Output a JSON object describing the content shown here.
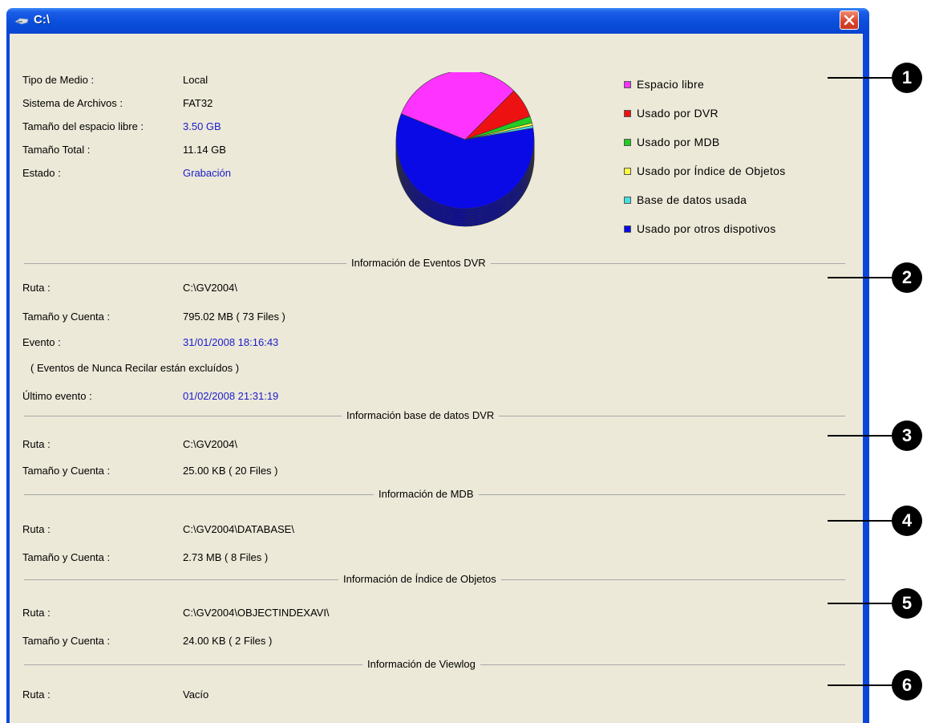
{
  "window": {
    "title": "C:\\"
  },
  "disk_info": {
    "media_type_label": "Tipo de Medio :",
    "media_type_value": "Local",
    "filesystem_label": "Sistema de Archivos :",
    "filesystem_value": "FAT32",
    "free_space_label": "Tamaño del espacio libre :",
    "free_space_value": "3.50 GB",
    "total_size_label": "Tamaño Total :",
    "total_size_value": "11.14 GB",
    "status_label": "Estado :",
    "status_value": "Grabación"
  },
  "legend": [
    {
      "label": "Espacio libre",
      "color": "#ff33ff"
    },
    {
      "label": "Usado por DVR",
      "color": "#ee1111"
    },
    {
      "label": "Usado por MDB",
      "color": "#22cc22"
    },
    {
      "label": "Usado por Índice de Objetos",
      "color": "#ffff44"
    },
    {
      "label": "Base de datos usada",
      "color": "#44e0e0"
    },
    {
      "label": "Usado por otros dispotivos",
      "color": "#0a0ae6"
    }
  ],
  "chart_data": {
    "type": "pie",
    "slices": [
      {
        "label": "Espacio libre",
        "value": 31.4,
        "color": "#ff33ff"
      },
      {
        "label": "Usado por DVR",
        "value": 7.0,
        "color": "#ee1111"
      },
      {
        "label": "Usado por MDB",
        "value": 1.6,
        "color": "#22cc22"
      },
      {
        "label": "Usado por Índice de Objetos",
        "value": 0.6,
        "color": "#ffff44"
      },
      {
        "label": "Base de datos usada",
        "value": 0.6,
        "color": "#44e0e0"
      },
      {
        "label": "Usado por otros dispotivos",
        "value": 58.8,
        "color": "#0a0ae6"
      }
    ]
  },
  "events_section": {
    "title": "Información de Eventos DVR",
    "path_label": "Ruta :",
    "path_value": "C:\\GV2004\\",
    "size_label": "Tamaño y Cuenta :",
    "size_value": "795.02 MB ( 73 Files )",
    "event_label": "Evento :",
    "event_value": "31/01/2008 18:16:43",
    "note": "( Eventos de Nunca Recilar están excluídos )",
    "last_event_label": "Último evento :",
    "last_event_value": "01/02/2008 21:31:19"
  },
  "db_section": {
    "title": "Información base de datos DVR",
    "path_label": "Ruta :",
    "path_value": "C:\\GV2004\\",
    "size_label": "Tamaño y Cuenta :",
    "size_value": "25.00 KB ( 20 Files )"
  },
  "mdb_section": {
    "title": "Información de MDB",
    "path_label": "Ruta :",
    "path_value": "C:\\GV2004\\DATABASE\\",
    "size_label": "Tamaño y Cuenta :",
    "size_value": "2.73 MB ( 8 Files )"
  },
  "object_index_section": {
    "title": "Información de Índice de Objetos",
    "path_label": "Ruta :",
    "path_value": "C:\\GV2004\\OBJECTINDEXAVI\\",
    "size_label": "Tamaño y Cuenta :",
    "size_value": "24.00 KB ( 2 Files )"
  },
  "viewlog_section": {
    "title": "Información  de Viewlog",
    "path_label": "Ruta :",
    "path_value": "Vacío"
  },
  "callouts": [
    "1",
    "2",
    "3",
    "4",
    "5",
    "6"
  ]
}
